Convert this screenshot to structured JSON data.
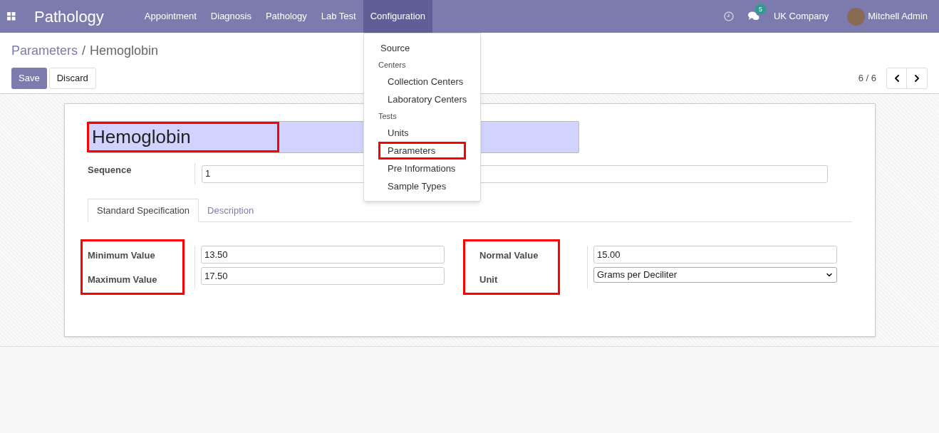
{
  "navbar": {
    "app_name": "Pathology",
    "menus": [
      {
        "label": "Appointment",
        "selected": false
      },
      {
        "label": "Diagnosis",
        "selected": false
      },
      {
        "label": "Pathology",
        "selected": false
      },
      {
        "label": "Lab Test",
        "selected": false
      },
      {
        "label": "Configuration",
        "selected": true
      }
    ],
    "messages_count": "5",
    "company": "UK Company",
    "user": "Mitchell Admin"
  },
  "dropdown": [
    {
      "kind": "item",
      "label": "Source",
      "highlighted": false
    },
    {
      "kind": "header",
      "label": "Centers"
    },
    {
      "kind": "subitem",
      "label": "Collection Centers",
      "highlighted": false
    },
    {
      "kind": "subitem",
      "label": "Laboratory Centers",
      "highlighted": false
    },
    {
      "kind": "header",
      "label": "Tests"
    },
    {
      "kind": "subitem",
      "label": "Units",
      "highlighted": false
    },
    {
      "kind": "subitem",
      "label": "Parameters",
      "highlighted": true
    },
    {
      "kind": "subitem",
      "label": "Pre Informations",
      "highlighted": false
    },
    {
      "kind": "subitem",
      "label": "Sample Types",
      "highlighted": false
    }
  ],
  "breadcrumb": {
    "parent": "Parameters",
    "separator": "/",
    "current": "Hemoglobin"
  },
  "buttons": {
    "save": "Save",
    "discard": "Discard"
  },
  "pager": {
    "value": "6 / 6"
  },
  "form": {
    "name": "Hemoglobin",
    "name_highlighted": true,
    "sequence_label": "Sequence",
    "sequence": "1",
    "tabs": [
      {
        "label": "Standard Specification",
        "selected": true
      },
      {
        "label": "Description",
        "selected": false
      }
    ],
    "groups": [
      {
        "highlighted": true,
        "fields": [
          {
            "label": "Minimum Value",
            "value": "13.50",
            "kind": "text"
          },
          {
            "label": "Maximum Value",
            "value": "17.50",
            "kind": "text"
          }
        ]
      },
      {
        "highlighted": true,
        "fields": [
          {
            "label": "Normal Value",
            "value": "15.00",
            "kind": "text"
          },
          {
            "label": "Unit",
            "value": "Grams per Deciliter",
            "kind": "select"
          }
        ]
      }
    ]
  }
}
